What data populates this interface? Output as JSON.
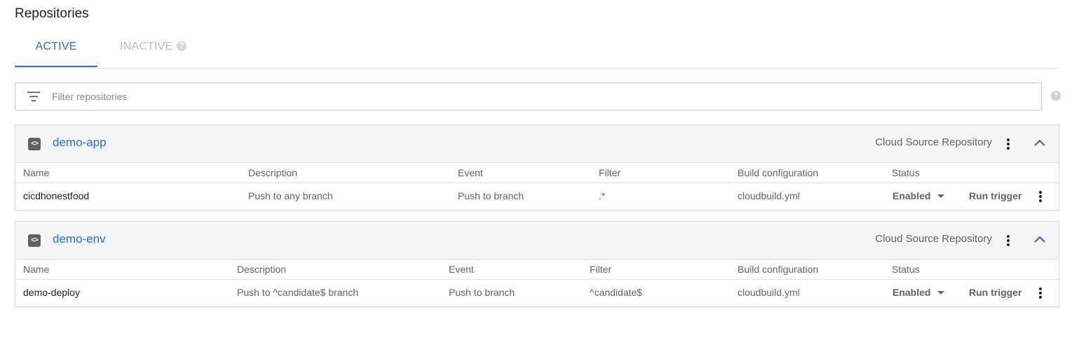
{
  "page": {
    "title": "Repositories"
  },
  "tabs": [
    {
      "label": "ACTIVE",
      "active": true
    },
    {
      "label": "INACTIVE",
      "active": false
    }
  ],
  "filter": {
    "placeholder": "Filter repositories",
    "value": ""
  },
  "colors": {
    "accent": "#3367d6",
    "inactive_tab": "#bdbdbd",
    "header_bg": "#f5f5f5"
  },
  "repositories": [
    {
      "name": "demo-app",
      "type": "Cloud Source Repository",
      "icon": "code-icon",
      "columns": [
        "Name",
        "Description",
        "Event",
        "Filter",
        "Build configuration",
        "Status"
      ],
      "triggers": [
        {
          "name": "cicdhonestfood",
          "description": "Push to any branch",
          "event": "Push to branch",
          "filter": ".*",
          "build_config": "cloudbuild.yml",
          "status": "Enabled",
          "action": "Run trigger"
        }
      ]
    },
    {
      "name": "demo-env",
      "type": "Cloud Source Repository",
      "icon": "code-icon",
      "columns": [
        "Name",
        "Description",
        "Event",
        "Filter",
        "Build configuration",
        "Status"
      ],
      "triggers": [
        {
          "name": "demo-deploy",
          "description": "Push to ^candidate$ branch",
          "event": "Push to branch",
          "filter": "^candidate$",
          "build_config": "cloudbuild.yml",
          "status": "Enabled",
          "action": "Run trigger"
        }
      ]
    }
  ]
}
